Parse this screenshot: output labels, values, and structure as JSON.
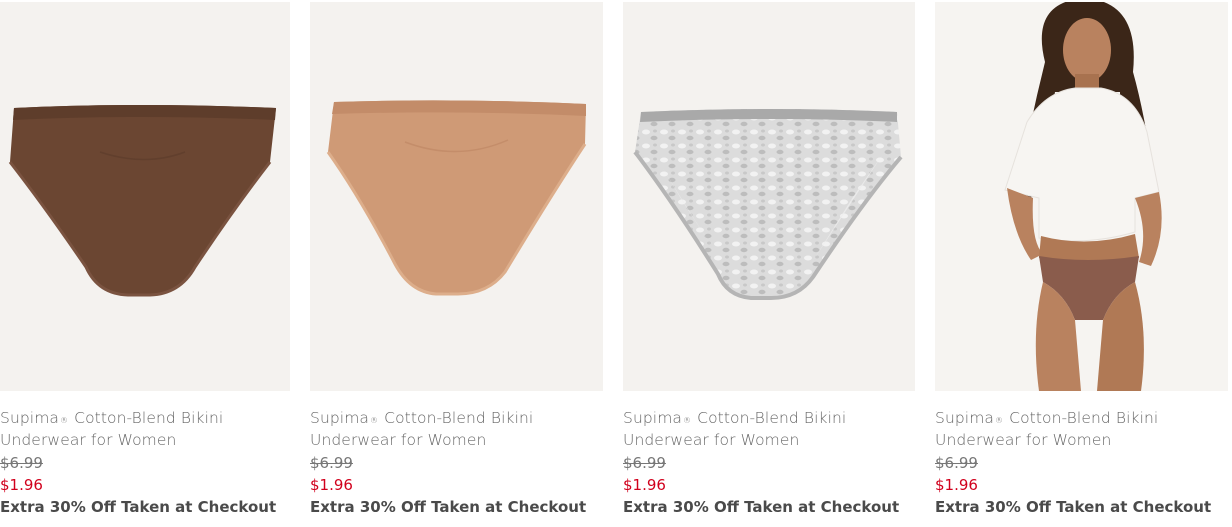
{
  "products": [
    {
      "name_a": "Supima",
      "name_reg": "®",
      "name_b": " Cotton-Blend Bikini",
      "name_c": "Underwear for Women",
      "was_price": "$6.99",
      "sale_price": "$1.96",
      "promo": "Extra 30% Off Taken at Checkout",
      "color": "#6b4632"
    },
    {
      "name_a": "Supima",
      "name_reg": "®",
      "name_b": " Cotton-Blend Bikini",
      "name_c": "Underwear for Women",
      "was_price": "$6.99",
      "sale_price": "$1.96",
      "promo": "Extra 30% Off Taken at Checkout",
      "color": "#cf9a76"
    },
    {
      "name_a": "Supima",
      "name_reg": "®",
      "name_b": " Cotton-Blend Bikini",
      "name_c": "Underwear for Women",
      "was_price": "$6.99",
      "sale_price": "$1.96",
      "promo": "Extra 30% Off Taken at Checkout",
      "color": "#d5d5d5"
    },
    {
      "name_a": "Supima",
      "name_reg": "®",
      "name_b": " Cotton-Blend Bikini",
      "name_c": "Underwear for Women",
      "was_price": "$6.99",
      "sale_price": "$1.96",
      "promo": "Extra 30% Off Taken at Checkout",
      "color": "#8a5c4c"
    }
  ],
  "colors": {
    "sale": "#d1001c",
    "image_bg": "#f4f2ef"
  }
}
